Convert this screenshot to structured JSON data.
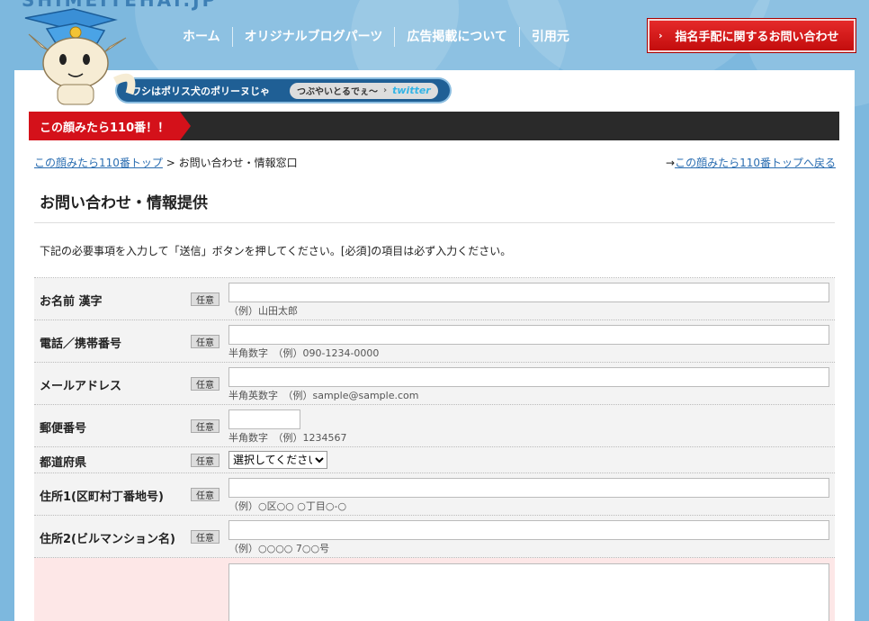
{
  "header": {
    "logo": "SHIMEITEHAI.JP",
    "nav": [
      "ホーム",
      "オリジナルブログパーツ",
      "広告掲載について",
      "引用元"
    ],
    "contact_button": "指名手配に関するお問い合わせ",
    "contact_arrow": "›",
    "tagline": "ワシはポリス犬のポリーヌじゃ",
    "twitter_text": "つぶやいとるでぇ～",
    "twitter_arrow": "›",
    "twitter_logo": "twitter"
  },
  "title_bar": {
    "label": "この顔みたら110番！！"
  },
  "breadcrumb": {
    "home": "この顔みたら110番トップ",
    "separator": ">",
    "current": "お問い合わせ・情報窓口",
    "back_arrow": "→",
    "back_link": "この顔みたら110番トップへ戻る"
  },
  "page_title": "お問い合わせ・情報提供",
  "intro": "下記の必要事項を入力して「送信」ボタンを押してください。[必須]の項目は必ず入力ください。",
  "form": {
    "badge": "任意",
    "name": {
      "label": "お名前 漢字",
      "hint": "（例）山田太郎",
      "value": ""
    },
    "phone": {
      "label": "電話／携帯番号",
      "hint": "半角数字　（例）090-1234-0000",
      "value": ""
    },
    "email": {
      "label": "メールアドレス",
      "hint": "半角英数字　（例）sample@sample.com",
      "value": ""
    },
    "zip": {
      "label": "郵便番号",
      "hint": "半角数字　（例）1234567",
      "value": ""
    },
    "prefecture": {
      "label": "都道府県",
      "selected": "選択してください"
    },
    "address1": {
      "label": "住所1(区町村丁番地号)",
      "hint": "（例）○区○○ ○丁目○-○",
      "value": ""
    },
    "address2": {
      "label": "住所2(ビルマンション名)",
      "hint": "（例）○○○○ 7○○号",
      "value": ""
    }
  },
  "colors": {
    "header_bg": "#7db8de",
    "accent_red": "#d4111a",
    "link": "#2a6db1",
    "dark_bar": "#2a2a2a"
  }
}
